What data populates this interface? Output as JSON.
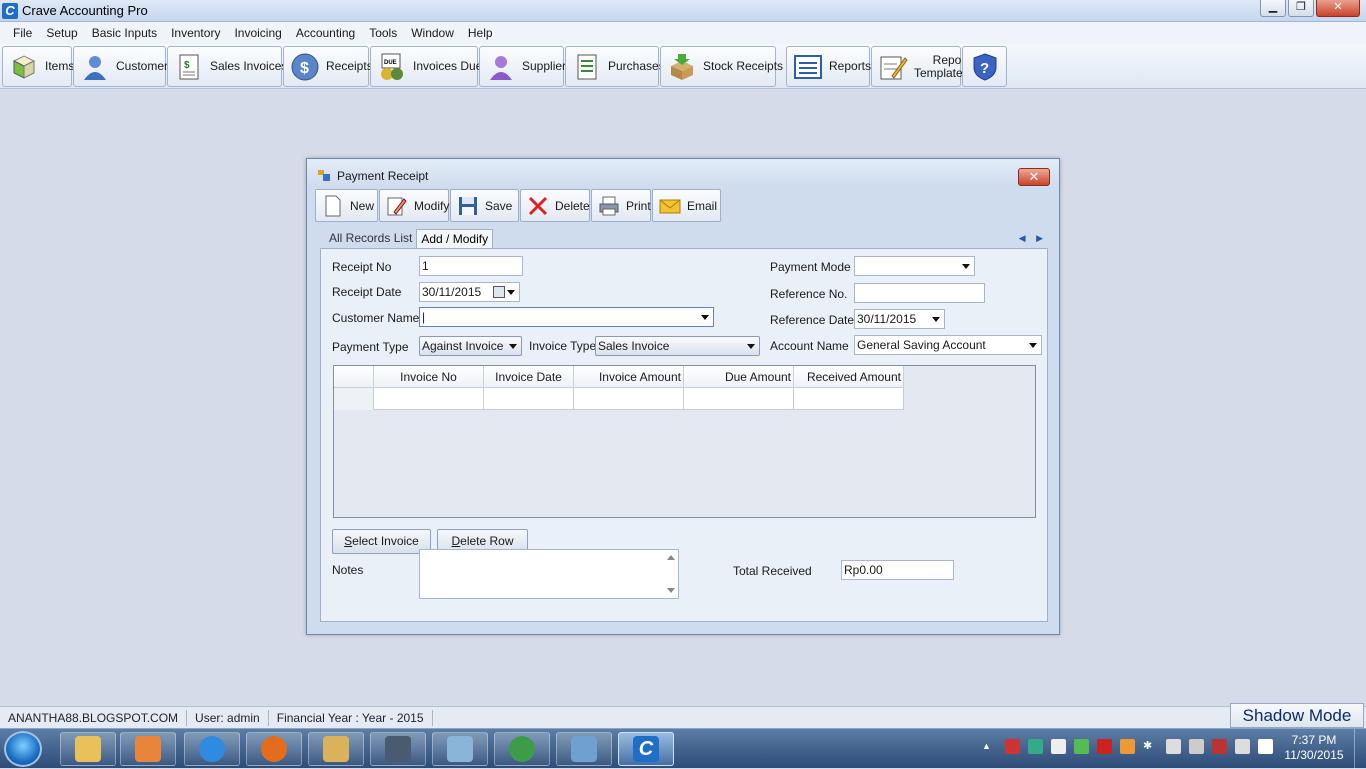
{
  "window": {
    "title": "Crave Accounting Pro",
    "app_icon_letter": "C"
  },
  "menu": [
    "File",
    "Setup",
    "Basic Inputs",
    "Inventory",
    "Invoicing",
    "Accounting",
    "Tools",
    "Window",
    "Help"
  ],
  "toolbar": {
    "items": "Items",
    "customers": "Customers",
    "sales_invoices": "Sales Invoices",
    "receipts": "Receipts",
    "invoices_due": "Invoices Due",
    "suppliers": "Suppliers",
    "purchases": "Purchases",
    "stock_receipts": "Stock Receipts",
    "reports": "Reports",
    "report_templates_1": "Report",
    "report_templates_2": "Templates",
    "due_badge": "DUE",
    "help_glyph": "?"
  },
  "dialog": {
    "title": "Payment Receipt",
    "close": "✕",
    "buttons": {
      "new": "New",
      "modify": "Modify",
      "save": "Save",
      "delete": "Delete",
      "print": "Print",
      "email": "Email"
    },
    "tabs": {
      "all_records": "All Records List",
      "add_modify": "Add / Modify"
    },
    "tab_arrows": "◀ ▶",
    "fields": {
      "receipt_no_label": "Receipt No",
      "receipt_no": "1",
      "receipt_date_label": "Receipt Date",
      "receipt_date": "30/11/2015",
      "customer_name_label": "Customer Name",
      "customer_name": "|",
      "payment_type_label": "Payment Type",
      "payment_type": "Against Invoice",
      "invoice_type_label": "Invoice Type",
      "invoice_type": "Sales Invoice",
      "payment_mode_label": "Payment Mode",
      "payment_mode": "",
      "reference_no_label": "Reference No.",
      "reference_no": "",
      "reference_date_label": "Reference Date",
      "reference_date": "30/11/2015",
      "account_name_label": "Account Name",
      "account_name": "General Saving Account"
    },
    "grid": {
      "columns": [
        "Invoice No",
        "Invoice Date",
        "Invoice Amount",
        "Due Amount",
        "Received Amount"
      ]
    },
    "select_invoice_prefix": "S",
    "select_invoice_rest": "elect Invoice",
    "delete_row_prefix": "D",
    "delete_row_rest": "elete Row",
    "notes_label": "Notes",
    "total_received_label": "Total Received",
    "total_received": "Rp0.00"
  },
  "status": {
    "blog": "ANANTHA88.BLOGSPOT.COM",
    "user": "User: admin",
    "financial_year": "Financial Year : Year - 2015",
    "shadow_mode": "Shadow Mode"
  },
  "taskbar": {
    "time": "7:37 PM",
    "date": "11/30/2015",
    "active_letter": "C"
  }
}
